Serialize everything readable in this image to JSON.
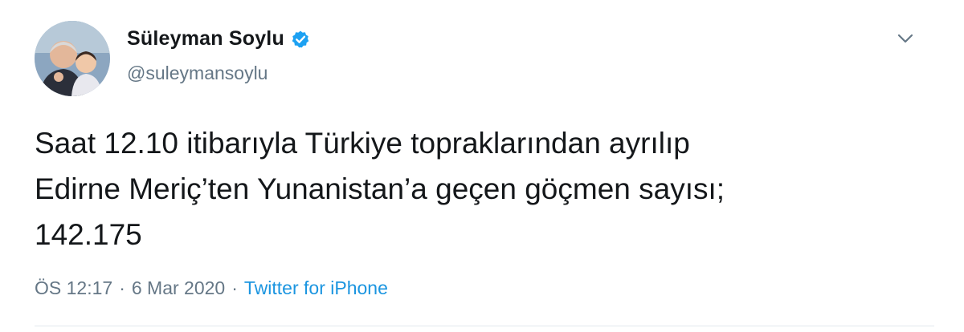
{
  "tweet": {
    "author": {
      "display_name": "Süleyman Soylu",
      "handle": "@suleymansoylu",
      "verified": true
    },
    "text": "Saat 12.10 itibarıyla Türkiye topraklarından ayrılıp\nEdirne Meriç’ten Yunanistan’a geçen göçmen sayısı;\n142.175",
    "time": "ÖS 12:17",
    "separator": "·",
    "date": "6 Mar 2020",
    "source": "Twitter for iPhone"
  },
  "colors": {
    "text": "#14171a",
    "secondary": "#657786",
    "accent": "#1b95e0",
    "verified": "#1da1f2"
  },
  "icons": {
    "verified": "verified-badge-icon",
    "menu": "chevron-down-icon"
  }
}
